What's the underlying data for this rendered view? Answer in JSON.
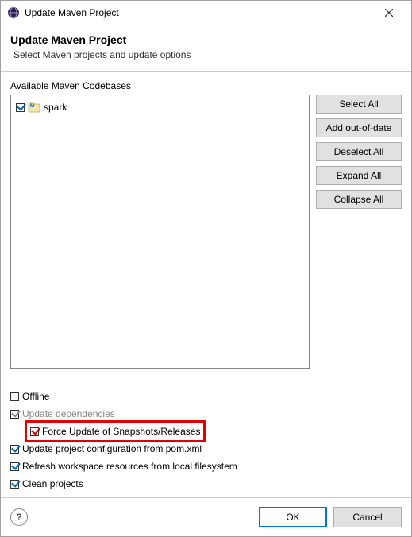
{
  "titlebar": {
    "title": "Update Maven Project"
  },
  "header": {
    "title": "Update Maven Project",
    "subtitle": "Select Maven projects and update options"
  },
  "codebases": {
    "label": "Available Maven Codebases",
    "items": [
      {
        "name": "spark",
        "checked": true
      }
    ]
  },
  "buttons": {
    "select_all": "Select All",
    "add_out_of_date": "Add out-of-date",
    "deselect_all": "Deselect All",
    "expand_all": "Expand All",
    "collapse_all": "Collapse All"
  },
  "checks": {
    "offline": "Offline",
    "update_dependencies": "Update dependencies",
    "force_update": "Force Update of Snapshots/Releases",
    "update_config": "Update project configuration from pom.xml",
    "refresh_workspace": "Refresh workspace resources from local filesystem",
    "clean_projects": "Clean projects"
  },
  "footer": {
    "ok": "OK",
    "cancel": "Cancel"
  }
}
